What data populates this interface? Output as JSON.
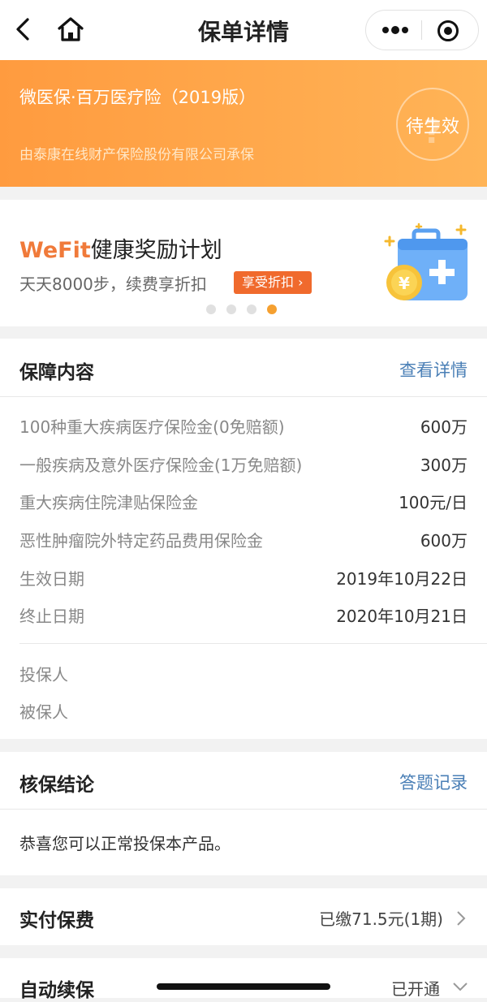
{
  "nav": {
    "title": "保单详情"
  },
  "banner": {
    "product_name": "微医保·百万医疗险（2019版）",
    "underwriter": "由泰康在线财产保险股份有限公司承保",
    "status": "待生效"
  },
  "promo": {
    "title_brand": "WeFit",
    "title_rest": "健康奖励计划",
    "subtitle": "天天8000步，续费享折扣",
    "badge": "享受折扣",
    "page_count": 4,
    "active_page": 4
  },
  "coverage": {
    "title": "保障内容",
    "link": "查看详情",
    "items": [
      {
        "label": "100种重大疾病医疗保险金(0免赔额)",
        "value": "600万"
      },
      {
        "label": "一般疾病及意外医疗保险金(1万免赔额)",
        "value": "300万"
      },
      {
        "label": "重大疾病住院津贴保险金",
        "value": "100元/日"
      },
      {
        "label": "恶性肿瘤院外特定药品费用保险金",
        "value": "600万"
      },
      {
        "label": "生效日期",
        "value": "2019年10月22日"
      },
      {
        "label": "终止日期",
        "value": "2020年10月21日"
      }
    ],
    "policyholder_label": "投保人",
    "insured_label": "被保人"
  },
  "underwriting": {
    "title": "核保结论",
    "link": "答题记录",
    "result": "恭喜您可以正常投保本产品。"
  },
  "payment": {
    "title": "实付保费",
    "value": "已缴71.5元(1期)"
  },
  "renewal": {
    "title": "自动续保",
    "value": "已开通"
  }
}
